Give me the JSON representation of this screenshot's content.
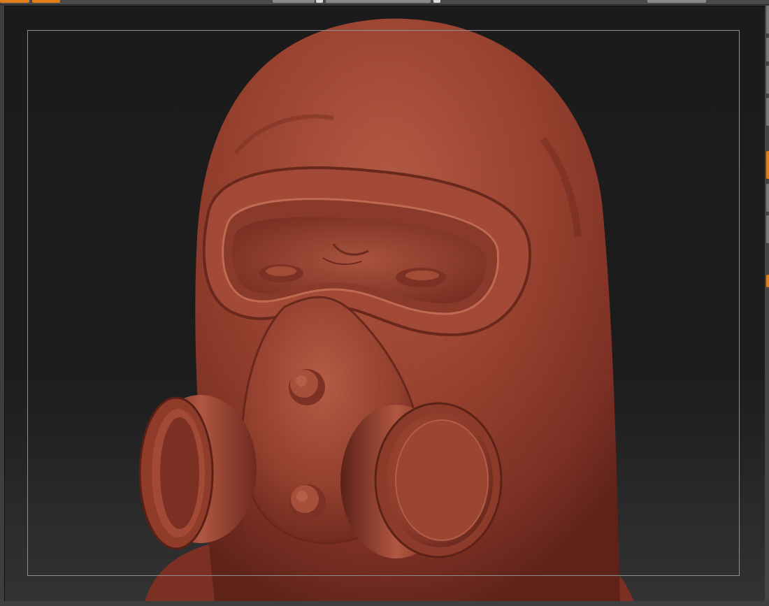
{
  "app": {
    "viewport_label": "",
    "model_color": "#9a4331",
    "accent_color": "#e07e1a",
    "background_top": "#1b1b1b",
    "background_bottom": "#333333"
  },
  "toolbar": {
    "left_buttons": [
      "active",
      "active"
    ],
    "center_markers": [
      "marker",
      "marker"
    ]
  },
  "right_tray": {
    "buttons": [
      "grey",
      "grey",
      "grey",
      "orange",
      "grey",
      "grey",
      "grey",
      "orange"
    ]
  }
}
